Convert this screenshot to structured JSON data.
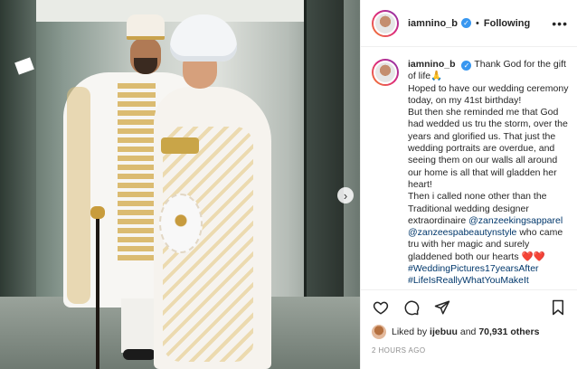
{
  "post": {
    "username": "iamnino_b",
    "follow_status": "Following",
    "more_icon": "ellipsis-icon",
    "next_icon": "chevron-right-icon"
  },
  "caption": {
    "username": "iamnino_b",
    "lines": [
      "Thank God for the gift of life🙏",
      "Hoped to have our wedding ceremony today, on my 41st birthday!",
      "But then she reminded me that God had wedded us tru the storm, over the years and glorified us. That just the wedding portraits are overdue, and seeing them on our walls all around our home is all that will gladden her heart!",
      "Then i called none other than the Traditional wedding designer extraordinaire"
    ],
    "mention_1": "@zanzeekingsapparel",
    "mention_2": "@zanzeespabeautynstyle",
    "after_mentions": " who came tru with her magic and surely gladdened both our hearts ❤️❤️",
    "hashtag_1": "#WeddingPictures17yearsAfter",
    "hashtag_2": "#LifeIsReallyWhatYouMakeIt"
  },
  "actions": {
    "like_icon": "heart-icon",
    "comment_icon": "comment-icon",
    "share_icon": "share-icon",
    "save_icon": "bookmark-icon"
  },
  "likes": {
    "prefix": "Liked by ",
    "liker": "ijebuu",
    "middle": " and ",
    "count": "70,931 others"
  },
  "timestamp": "2 hours ago",
  "colors": {
    "link": "#00376b",
    "verified": "#3897f0",
    "muted": "#8e8e8e",
    "text": "#262626"
  }
}
